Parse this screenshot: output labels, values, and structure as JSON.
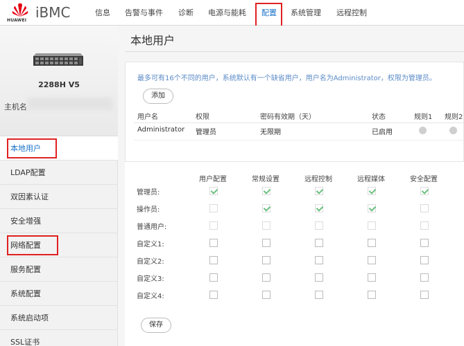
{
  "app": {
    "logo_text": "HUAWEI",
    "brand": "iBMC"
  },
  "nav": [
    {
      "label": "信息",
      "active": false
    },
    {
      "label": "告警与事件",
      "active": false
    },
    {
      "label": "诊断",
      "active": false
    },
    {
      "label": "电源与能耗",
      "active": false
    },
    {
      "label": "配置",
      "active": true
    },
    {
      "label": "系统管理",
      "active": false
    },
    {
      "label": "远程控制",
      "active": false
    }
  ],
  "server": {
    "model": "2288H V5",
    "host_label": "主机名"
  },
  "sidebar": {
    "items": [
      {
        "label": "本地用户",
        "active": true
      },
      {
        "label": "LDAP配置"
      },
      {
        "label": "双因素认证"
      },
      {
        "label": "安全增强"
      },
      {
        "label": "网络配置"
      },
      {
        "label": "服务配置"
      },
      {
        "label": "系统配置"
      },
      {
        "label": "系统启动项"
      },
      {
        "label": "SSL证书"
      }
    ]
  },
  "page": {
    "title": "本地用户",
    "note": "最多可有16个不同的用户，系统默认有一个缺省用户，用户名为Administrator，权限为管理员。",
    "add_label": "添加",
    "save_label": "保存"
  },
  "users_table": {
    "headers": [
      "用户名",
      "权限",
      "密码有效期（天）",
      "状态",
      "规则1",
      "规则2"
    ],
    "rows": [
      {
        "username": "Administrator",
        "role": "管理员",
        "expiry": "无限期",
        "status": "已启用"
      }
    ]
  },
  "permissions": {
    "columns": [
      "用户配置",
      "常规设置",
      "远程控制",
      "远程媒体",
      "安全配置"
    ],
    "rows": [
      {
        "label": "管理员:",
        "checked": [
          true,
          true,
          true,
          true,
          true
        ],
        "disabled": true
      },
      {
        "label": "操作员:",
        "checked": [
          false,
          true,
          true,
          true,
          false
        ],
        "disabled": true
      },
      {
        "label": "普通用户:",
        "checked": [
          false,
          false,
          false,
          false,
          false
        ],
        "disabled": true
      },
      {
        "label": "自定义1:",
        "checked": [
          false,
          false,
          false,
          false,
          false
        ],
        "disabled": false
      },
      {
        "label": "自定义2:",
        "checked": [
          false,
          false,
          false,
          false,
          false
        ],
        "disabled": false
      },
      {
        "label": "自定义3:",
        "checked": [
          false,
          false,
          false,
          false,
          false
        ],
        "disabled": false
      },
      {
        "label": "自定义4:",
        "checked": [
          false,
          false,
          false,
          false,
          false
        ],
        "disabled": false
      }
    ]
  },
  "colors": {
    "accent": "#1a73c8",
    "highlight_box": "#e02020",
    "check": "#6cc080",
    "logo_red": "#e60012"
  }
}
